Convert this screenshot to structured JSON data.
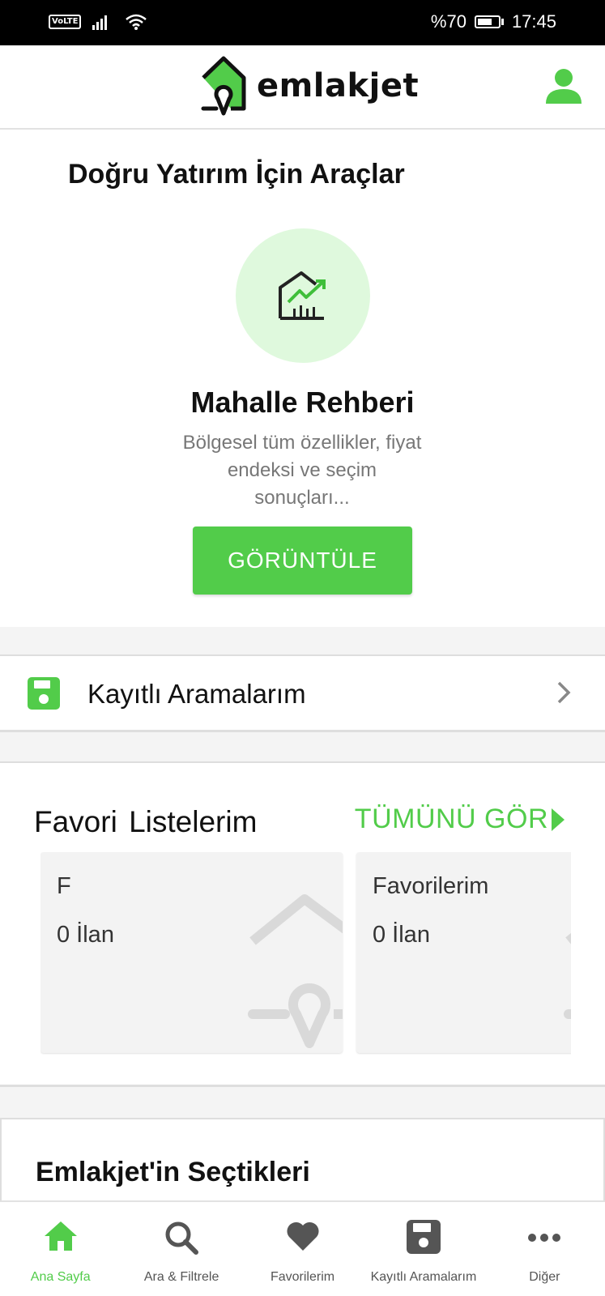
{
  "status_bar": {
    "network": "VoLTE",
    "battery": "%70",
    "battery_level": 0.7,
    "time": "17:45"
  },
  "header": {
    "logo_text": "emlakjet",
    "brand_color": "#52cc4a"
  },
  "tools": {
    "title": "Doğru Yatırım İçin Araçlar",
    "card_title": "Mahalle Rehberi",
    "description": "Bölgesel tüm özellikler, fiyat endeksi ve seçim sonuçları...",
    "button_label": "GÖRÜNTÜLE",
    "icon": "chart-house-icon"
  },
  "saved_searches": {
    "label": "Kayıtlı Aramalarım",
    "icon": "save-icon"
  },
  "favorites": {
    "title": "Favori Listelerim",
    "see_all": "TÜMÜNÜ GÖR",
    "cards": [
      {
        "name": "F",
        "count": "0 İlan"
      },
      {
        "name": "Favorilerim",
        "count": "0 İlan"
      }
    ]
  },
  "picks": {
    "title": "Emlakjet'in Seçtikleri"
  },
  "bottom_nav": {
    "items": [
      {
        "label": "Ana Sayfa",
        "icon": "home-icon",
        "active": true
      },
      {
        "label": "Ara & Filtrele",
        "icon": "search-icon",
        "active": false
      },
      {
        "label": "Favorilerim",
        "icon": "heart-icon",
        "active": false
      },
      {
        "label": "Kayıtlı Aramalarım",
        "icon": "save-icon",
        "active": false
      },
      {
        "label": "Diğer",
        "icon": "more-icon",
        "active": false
      }
    ]
  }
}
